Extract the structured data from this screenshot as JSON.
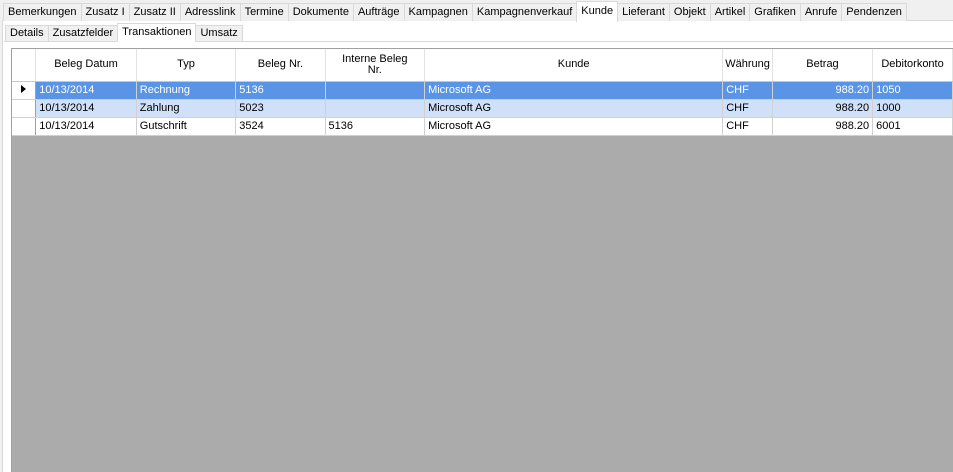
{
  "top_tabs": [
    "Bemerkungen",
    "Zusatz I",
    "Zusatz II",
    "Adresslink",
    "Termine",
    "Dokumente",
    "Aufträge",
    "Kampagnen",
    "Kampagnenverkauf",
    "Kunde",
    "Lieferant",
    "Objekt",
    "Artikel",
    "Grafiken",
    "Anrufe",
    "Pendenzen"
  ],
  "sub_tabs": [
    "Details",
    "Zusatzfelder",
    "Transaktionen",
    "Umsatz"
  ],
  "grid": {
    "columns": [
      "Beleg Datum",
      "Typ",
      "Beleg Nr.",
      "Interne Beleg Nr.",
      "Kunde",
      "Währung",
      "Betrag",
      "Debitorkonto"
    ],
    "rows": [
      [
        "10/13/2014",
        "Rechnung",
        "5136",
        "",
        "Microsoft AG",
        "CHF",
        "988.20",
        "1050"
      ],
      [
        "10/13/2014",
        "Zahlung",
        "5023",
        "",
        "Microsoft AG",
        "CHF",
        "988.20",
        "1000"
      ],
      [
        "10/13/2014",
        "Gutschrift",
        "3524",
        "5136",
        "Microsoft AG",
        "CHF",
        "988.20",
        "6001"
      ]
    ]
  },
  "colors": {
    "selected_row": "#5a94e6",
    "alt_row": "#cfe0f8",
    "grid_background": "#ababab"
  }
}
